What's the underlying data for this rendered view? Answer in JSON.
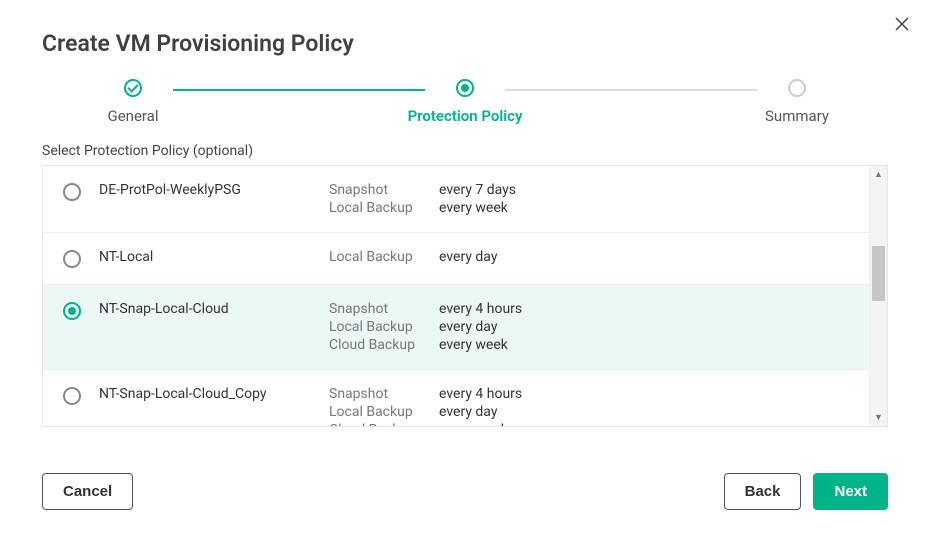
{
  "title": "Create VM Provisioning Policy",
  "subtitle": "Select Protection Policy (optional)",
  "stepper": {
    "steps": [
      {
        "label": "General",
        "state": "done"
      },
      {
        "label": "Protection Policy",
        "state": "active"
      },
      {
        "label": "Summary",
        "state": "pending"
      }
    ]
  },
  "policies": [
    {
      "name": "DE-ProtPol-WeeklyPSG",
      "selected": false,
      "schedules": [
        {
          "type": "Snapshot",
          "value": "every 7 days"
        },
        {
          "type": "Local Backup",
          "value": "every week"
        }
      ]
    },
    {
      "name": "NT-Local",
      "selected": false,
      "schedules": [
        {
          "type": "Local Backup",
          "value": "every day"
        }
      ]
    },
    {
      "name": "NT-Snap-Local-Cloud",
      "selected": true,
      "schedules": [
        {
          "type": "Snapshot",
          "value": "every 4 hours"
        },
        {
          "type": "Local Backup",
          "value": "every day"
        },
        {
          "type": "Cloud Backup",
          "value": "every week"
        }
      ]
    },
    {
      "name": "NT-Snap-Local-Cloud_Copy",
      "selected": false,
      "schedules": [
        {
          "type": "Snapshot",
          "value": "every 4 hours"
        },
        {
          "type": "Local Backup",
          "value": "every day"
        },
        {
          "type": "Cloud Backup",
          "value": "every week"
        }
      ]
    }
  ],
  "footer": {
    "cancel": "Cancel",
    "back": "Back",
    "next": "Next"
  },
  "colors": {
    "accent": "#00b388"
  }
}
